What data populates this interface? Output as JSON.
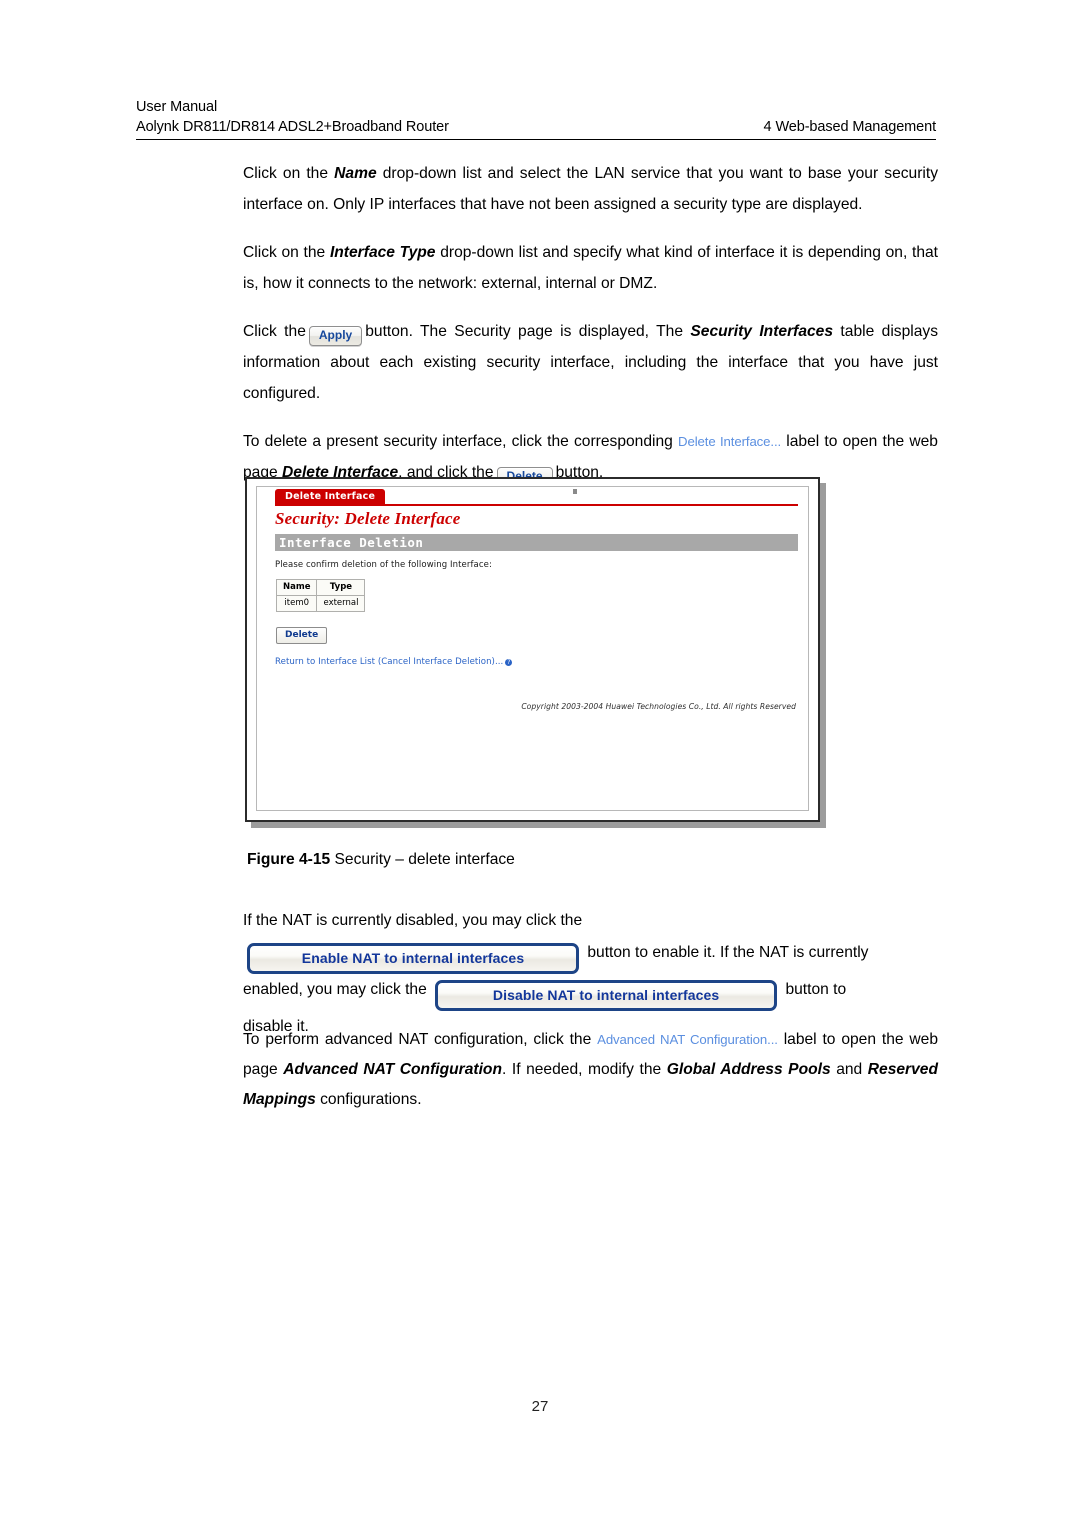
{
  "header": {
    "line1": "User Manual",
    "line2_left": "Aolynk DR811/DR814 ADSL2+Broadband Router",
    "line2_right": "4  Web-based Management"
  },
  "paragraphs": {
    "p1_a": "Click on the ",
    "p1_b": "Name",
    "p1_c": " drop-down list and select the LAN service that you want to base your security interface on. Only IP interfaces that have not been assigned a security type are displayed.",
    "p2_a": "Click on the ",
    "p2_b": "Interface Type",
    "p2_c": " drop-down list and specify what kind of interface it is depending on, that is, how it connects to the network: external, internal or DMZ.",
    "p3_a": "Click the",
    "p3_btn": "Apply",
    "p3_b": "button. The Security page is displayed, The ",
    "p3_bold": "Security Interfaces",
    "p3_c": " table displays information about each existing security interface, including the interface that you have just configured.",
    "p4_a": "To delete a present security interface, click the corresponding",
    "p4_link": "Delete Interface...",
    "p4_b": "label to open the web page ",
    "p4_bold": "Delete Interface",
    "p4_c": ", and click the",
    "p4_btn": "Delete",
    "p4_d": "button."
  },
  "figure": {
    "tab_label": "Delete Interface",
    "page_title": "Security: Delete Interface",
    "section_header": "Interface Deletion",
    "confirm_text": "Please confirm deletion of the following Interface:",
    "table": {
      "headers": [
        "Name",
        "Type"
      ],
      "rows": [
        [
          "item0",
          "external"
        ]
      ]
    },
    "delete_button": "Delete",
    "return_link": "Return to Interface List (Cancel Interface Deletion)...",
    "help_icon_glyph": "?",
    "copyright": "Copyright 2003-2004 Huawei Technologies Co., Ltd. All rights Reserved"
  },
  "caption": {
    "label": "Figure 4-15",
    "text": " Security – delete interface"
  },
  "nat": {
    "line1": "If the NAT is currently disabled, you may click the",
    "enable_button": "Enable NAT to internal interfaces",
    "line2": "button to enable it. If the NAT is currently",
    "line3": "enabled, you may click the",
    "disable_button": "Disable NAT to internal interfaces",
    "line4": "button to",
    "line5": "disable it."
  },
  "final": {
    "a": "To perform advanced NAT configuration, click the",
    "link": "Advanced NAT Configuration...",
    "b": "label to open the web page ",
    "bold1": "Advanced NAT Configuration",
    "c": ". If needed, modify the ",
    "bold2": "Global Address Pools",
    "d": " and ",
    "bold3": "Reserved Mappings",
    "e": " configurations."
  },
  "footer": {
    "page_number": "27"
  },
  "colors": {
    "accent_red": "#cc0000",
    "link_blue": "#5b8fe0",
    "button_text_blue": "#13379b",
    "section_bar_gray": "#a8a8a8"
  }
}
